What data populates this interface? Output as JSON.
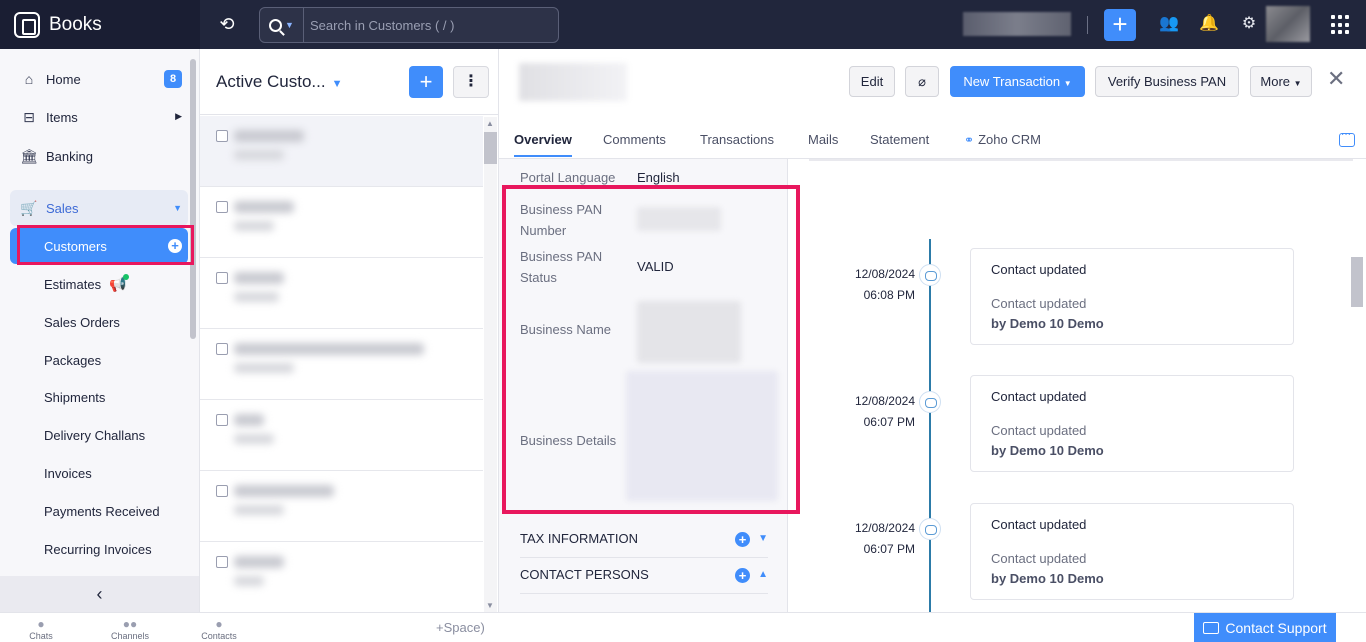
{
  "app": {
    "name": "Books"
  },
  "search": {
    "placeholder": "Search in Customers ( / )"
  },
  "sidebar": {
    "home": {
      "label": "Home",
      "badge": "8"
    },
    "items": {
      "label": "Items"
    },
    "banking": {
      "label": "Banking"
    },
    "sales": {
      "label": "Sales"
    },
    "sub": [
      "Customers",
      "Estimates",
      "Sales Orders",
      "Packages",
      "Shipments",
      "Delivery Challans",
      "Invoices",
      "Payments Received",
      "Recurring Invoices"
    ]
  },
  "list": {
    "title": "Active Custo..."
  },
  "detail": {
    "buttons": {
      "edit": "Edit",
      "new_transaction": "New Transaction",
      "verify_pan": "Verify Business PAN",
      "more": "More"
    },
    "tabs": [
      "Overview",
      "Comments",
      "Transactions",
      "Mails",
      "Statement",
      "Zoho CRM"
    ],
    "fields": {
      "portal_language": {
        "label": "Portal Language",
        "value": "English"
      },
      "pan_number": {
        "label_1": "Business PAN",
        "label_2": "Number"
      },
      "pan_status": {
        "label_1": "Business PAN",
        "label_2": "Status",
        "value": "VALID"
      },
      "business_name": {
        "label": "Business Name"
      },
      "business_details": {
        "label": "Business Details"
      }
    },
    "sections": {
      "tax": "TAX INFORMATION",
      "contacts": "CONTACT PERSONS"
    },
    "timeline": [
      {
        "date": "12/08/2024",
        "time": "06:08 PM",
        "title": "Contact updated",
        "desc": "Contact updated",
        "by": "by Demo 10 Demo"
      },
      {
        "date": "12/08/2024",
        "time": "06:07 PM",
        "title": "Contact updated",
        "desc": "Contact updated",
        "by": "by Demo 10 Demo"
      },
      {
        "date": "12/08/2024",
        "time": "06:07 PM",
        "title": "Contact updated",
        "desc": "Contact updated",
        "by": "by Demo 10 Demo"
      }
    ]
  },
  "bottombar": {
    "chats": "Chats",
    "channels": "Channels",
    "contacts": "Contacts",
    "hint": "+Space)",
    "support": "Contact Support"
  },
  "colors": {
    "accent": "#408dfb",
    "highlight": "#e8175d",
    "topbar": "#21263c"
  }
}
